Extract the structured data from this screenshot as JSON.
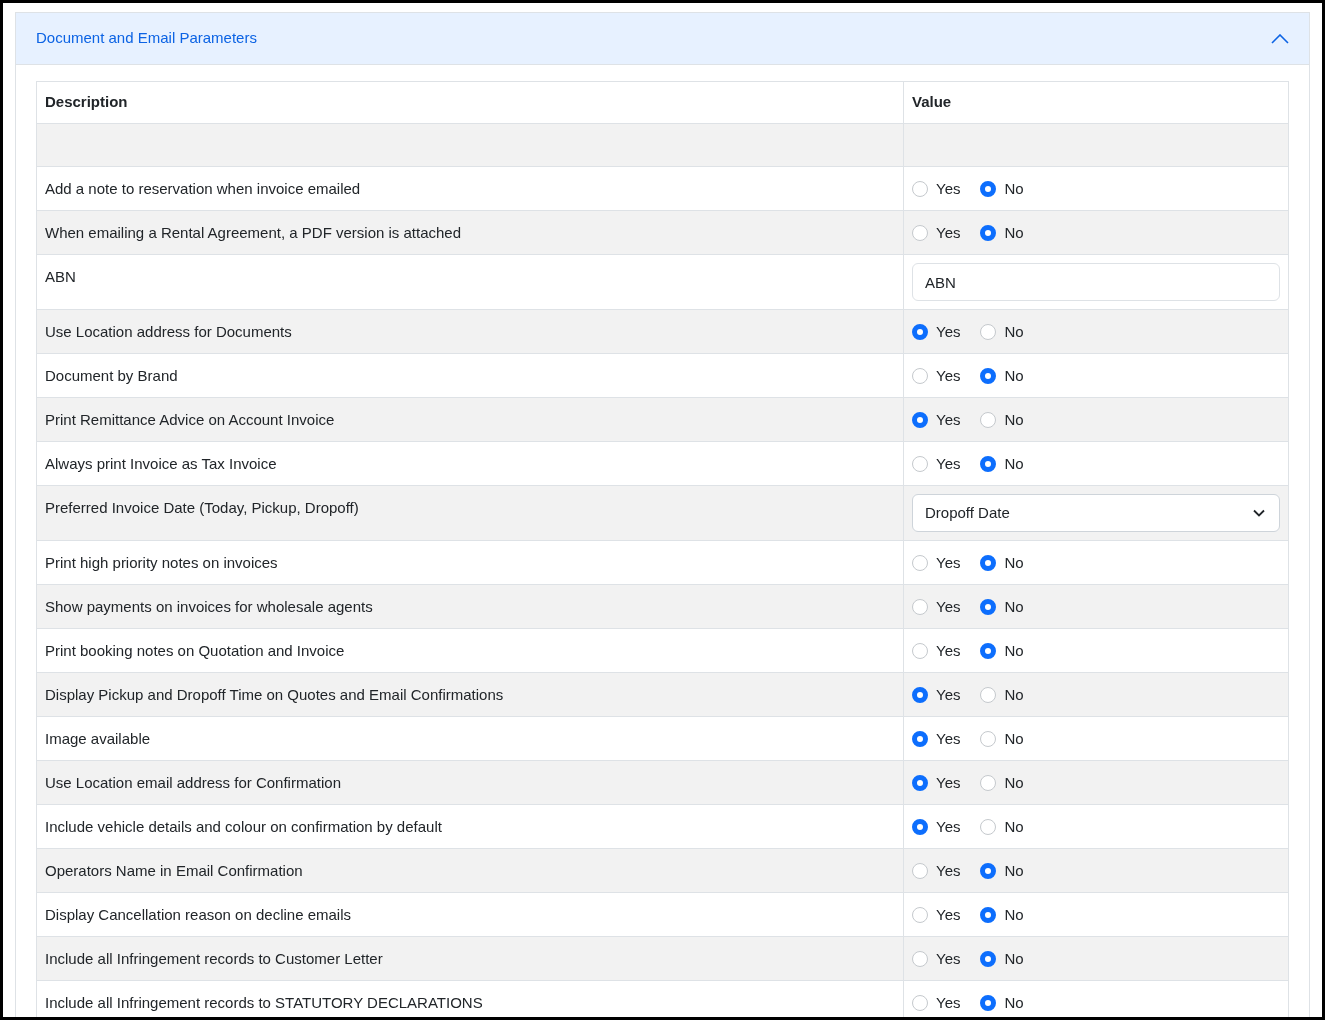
{
  "section": {
    "title": "Document and Email Parameters",
    "expanded": true
  },
  "table": {
    "columns": [
      "Description",
      "Value"
    ],
    "rows": [
      {
        "kind": "empty"
      },
      {
        "kind": "radio",
        "description": "Add a note to reservation when invoice emailed",
        "options": [
          {
            "label": "Yes",
            "selected": false
          },
          {
            "label": "No",
            "selected": true
          }
        ]
      },
      {
        "kind": "radio",
        "description": "When emailing a Rental Agreement, a PDF version is attached",
        "options": [
          {
            "label": "Yes",
            "selected": false
          },
          {
            "label": "No",
            "selected": true
          }
        ]
      },
      {
        "kind": "text",
        "description": "ABN",
        "value": "ABN"
      },
      {
        "kind": "radio",
        "description": "Use Location address for Documents",
        "options": [
          {
            "label": "Yes",
            "selected": true
          },
          {
            "label": "No",
            "selected": false
          }
        ]
      },
      {
        "kind": "radio",
        "description": "Document by Brand",
        "options": [
          {
            "label": "Yes",
            "selected": false
          },
          {
            "label": "No",
            "selected": true
          }
        ]
      },
      {
        "kind": "radio",
        "description": "Print Remittance Advice on Account Invoice",
        "options": [
          {
            "label": "Yes",
            "selected": true
          },
          {
            "label": "No",
            "selected": false
          }
        ]
      },
      {
        "kind": "radio",
        "description": "Always print Invoice as Tax Invoice",
        "options": [
          {
            "label": "Yes",
            "selected": false
          },
          {
            "label": "No",
            "selected": true
          }
        ]
      },
      {
        "kind": "select",
        "description": "Preferred Invoice Date (Today, Pickup, Dropoff)",
        "value": "Dropoff Date"
      },
      {
        "kind": "radio",
        "description": "Print high priority notes on invoices",
        "options": [
          {
            "label": "Yes",
            "selected": false
          },
          {
            "label": "No",
            "selected": true
          }
        ]
      },
      {
        "kind": "radio",
        "description": "Show payments on invoices for wholesale agents",
        "options": [
          {
            "label": "Yes",
            "selected": false
          },
          {
            "label": "No",
            "selected": true
          }
        ]
      },
      {
        "kind": "radio",
        "description": "Print booking notes on Quotation and Invoice",
        "options": [
          {
            "label": "Yes",
            "selected": false
          },
          {
            "label": "No",
            "selected": true
          }
        ]
      },
      {
        "kind": "radio",
        "description": "Display Pickup and Dropoff Time on Quotes and Email Confirmations",
        "options": [
          {
            "label": "Yes",
            "selected": true
          },
          {
            "label": "No",
            "selected": false
          }
        ]
      },
      {
        "kind": "radio",
        "description": "Image available",
        "options": [
          {
            "label": "Yes",
            "selected": true
          },
          {
            "label": "No",
            "selected": false
          }
        ]
      },
      {
        "kind": "radio",
        "description": "Use Location email address for Confirmation",
        "options": [
          {
            "label": "Yes",
            "selected": true
          },
          {
            "label": "No",
            "selected": false
          }
        ]
      },
      {
        "kind": "radio",
        "description": "Include vehicle details and colour on confirmation by default",
        "options": [
          {
            "label": "Yes",
            "selected": true
          },
          {
            "label": "No",
            "selected": false
          }
        ]
      },
      {
        "kind": "radio",
        "description": "Operators Name in Email Confirmation",
        "options": [
          {
            "label": "Yes",
            "selected": false
          },
          {
            "label": "No",
            "selected": true
          }
        ]
      },
      {
        "kind": "radio",
        "description": "Display Cancellation reason on decline emails",
        "options": [
          {
            "label": "Yes",
            "selected": false
          },
          {
            "label": "No",
            "selected": true
          }
        ]
      },
      {
        "kind": "radio",
        "description": "Include all Infringement records to Customer Letter",
        "options": [
          {
            "label": "Yes",
            "selected": false
          },
          {
            "label": "No",
            "selected": true
          }
        ]
      },
      {
        "kind": "radio",
        "description": "Include all Infringement records to STATUTORY DECLARATIONS",
        "options": [
          {
            "label": "Yes",
            "selected": false
          },
          {
            "label": "No",
            "selected": true
          }
        ]
      }
    ]
  }
}
